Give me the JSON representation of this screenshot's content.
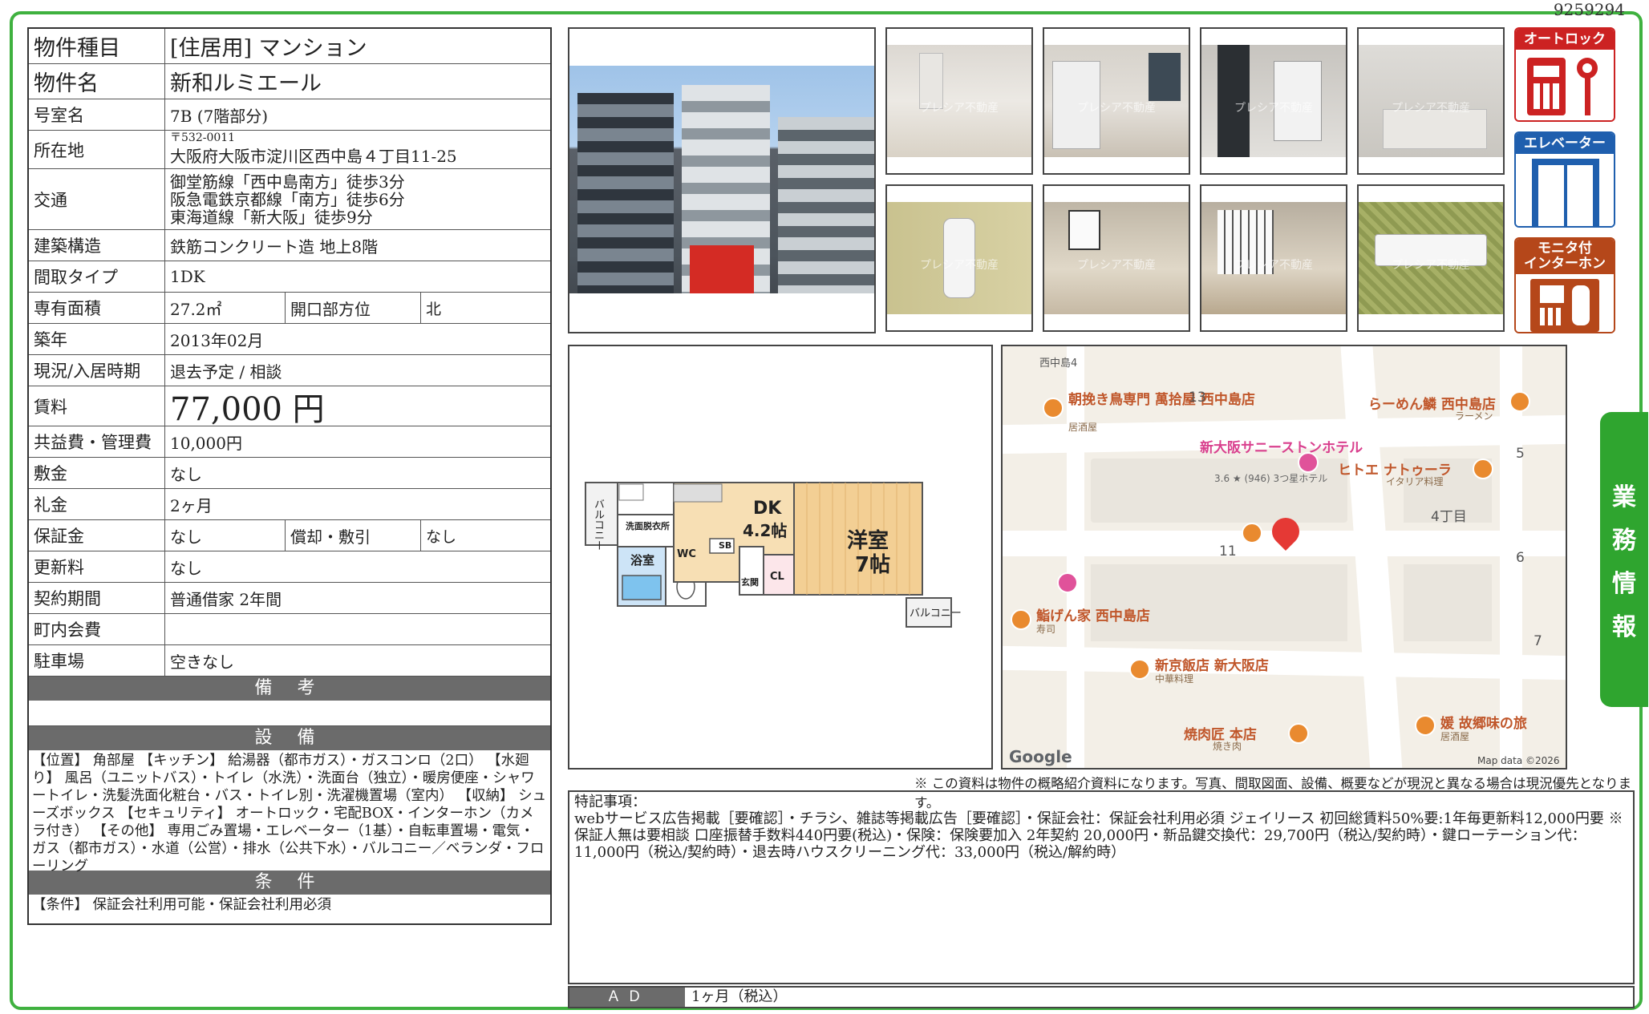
{
  "doc_id": "9259294",
  "property": {
    "rows": [
      {
        "label": "物件種目",
        "value": "[住居用] マンション"
      },
      {
        "label": "物件名",
        "value": "新和ルミエール"
      },
      {
        "label": "号室名",
        "value": "7B (7階部分)"
      },
      {
        "label": "所在地",
        "postal": "〒532-0011",
        "value": "大阪府大阪市淀川区西中島４丁目11-25"
      },
      {
        "label": "交通",
        "lines": [
          "御堂筋線「西中島南方」徒歩3分",
          "阪急電鉄京都線「南方」徒歩6分",
          "東海道線「新大阪」徒歩9分"
        ]
      },
      {
        "label": "建築構造",
        "value": "鉄筋コンクリート造 地上8階"
      },
      {
        "label": "間取タイプ",
        "value": "1DK"
      },
      {
        "label": "専有面積",
        "value": "27.2㎡",
        "sub_label": "開口部方位",
        "sub_value": "北"
      },
      {
        "label": "築年",
        "value": "2013年02月"
      },
      {
        "label": "現況/入居時期",
        "value": "退去予定 / 相談"
      },
      {
        "label": "賃料",
        "value": "77,000 円"
      },
      {
        "label": "共益費・管理費",
        "value": "10,000円"
      },
      {
        "label": "敷金",
        "value": "なし"
      },
      {
        "label": "礼金",
        "value": "2ヶ月"
      },
      {
        "label": "保証金",
        "value": "なし",
        "sub_label": "償却・敷引",
        "sub_value": "なし"
      },
      {
        "label": "更新料",
        "value": "なし"
      },
      {
        "label": "契約期間",
        "value": "普通借家 2年間"
      },
      {
        "label": "町内会費",
        "value": ""
      },
      {
        "label": "駐車場",
        "value": "空きなし"
      }
    ],
    "remarks_title": "備 考",
    "remarks": "",
    "equipment_title": "設 備",
    "equipment": "【位置】 角部屋 【キッチン】 給湯器（都市ガス）・ガスコンロ（2口） 【水廻り】 風呂（ユニットバス）・トイレ（水洗）・洗面台（独立）・暖房便座・シャワートイレ・洗髪洗面化粧台・バス・トイレ別・洗濯機置場（室内） 【収納】 シューズボックス 【セキュリティ】 オートロック・宅配BOX・インターホン（カメラ付き） 【その他】 専用ごみ置場・エレベーター（1基）・自転車置場・電気・ガス（都市ガス）・水道（公営）・排水（公共下水）・バルコニー／ベランダ・フローリング",
    "conditions_title": "条 件",
    "conditions": "【条件】 保証会社利用可能・保証会社利用必須"
  },
  "photos": {
    "watermark": "プレシア不動産",
    "count": 8
  },
  "feature_icons": [
    {
      "title": "オートロック",
      "icon": "autolock-icon",
      "color": "#cc2222"
    },
    {
      "title": "エレベーター",
      "icon": "elevator-icon",
      "color": "#1f5fae"
    },
    {
      "title": "モニタ付\nインターホン",
      "icon": "intercom-icon",
      "color": "#b5471a"
    }
  ],
  "floorplan": {
    "rooms": [
      {
        "name": "DK",
        "size": "4.2帖"
      },
      {
        "name": "洋室",
        "size": "7帖"
      }
    ],
    "labels": [
      "洗面脱衣所",
      "浴室",
      "WC",
      "SB",
      "玄関",
      "CL",
      "バルコニー",
      "バルコニー"
    ]
  },
  "map": {
    "places": [
      {
        "name": "朝挽き鳥専門 萬拾屋 西中島店",
        "category": "居酒屋"
      },
      {
        "name": "らーめん鱗 西中島店",
        "category": "ラーメン"
      },
      {
        "name": "新大阪サニーストンホテル",
        "category": "3.6 ★ (946) 3つ星ホテル"
      },
      {
        "name": "ヒトエ ナトゥーラ",
        "category": "イタリア料理"
      },
      {
        "name": "鮨げん家 西中島店",
        "category": "寿司"
      },
      {
        "name": "新京飯店 新大阪店",
        "category": "中華料理"
      },
      {
        "name": "焼肉匠 本店",
        "category": "焼き肉"
      },
      {
        "name": "媛 故郷味の旅",
        "category": "居酒屋"
      }
    ],
    "block_numbers": [
      "13",
      "5",
      "4丁目",
      "11",
      "6",
      "7"
    ],
    "station": "西中島4",
    "brand": "Google",
    "attribution": "Map data ©2026"
  },
  "side_tab": [
    "業",
    "務",
    "情",
    "報"
  ],
  "disclaimer": "※ この資料は物件の概略紹介資料になります。写真、間取図面、設備、概要などが現況と異なる場合は現況優先となります。",
  "special_notes": {
    "title": "特記事項：",
    "text": "webサービス広告掲載［要確認］・チラシ、雑誌等掲載広告［要確認］・保証会社：保証会社利用必須 ジェイリース 初回総賃料50%要:1年毎更新料12,000円要 ※保証人無は要相談 口座振替手数料440円要(税込)・保険：保険要加入 2年契約 20,000円・新品鍵交換代：29,700円（税込/契約時）・鍵ローテーション代：11,000円（税込/契約時）・退去時ハウスクリーニング代：33,000円（税込/解約時）"
  },
  "ad": {
    "label": "ＡＤ",
    "value": "1ヶ月（税込）"
  }
}
